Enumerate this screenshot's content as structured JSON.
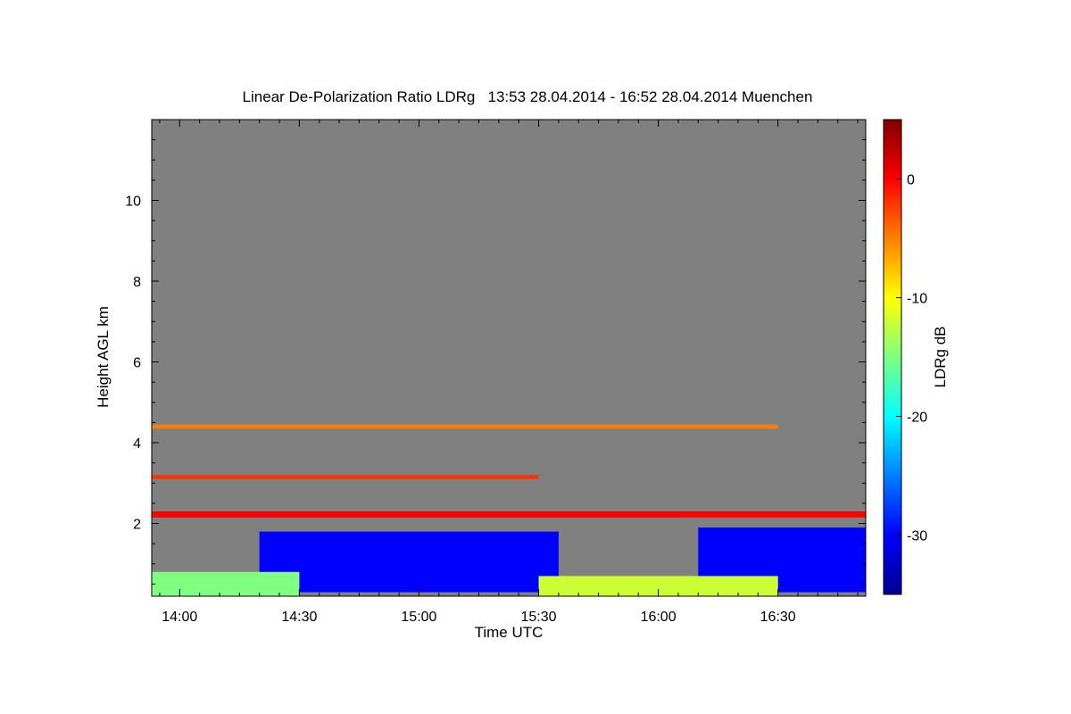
{
  "chart_data": {
    "type": "heatmap",
    "title": "Linear De-Polarization Ratio LDRg   13:53 28.04.2014 - 16:52 28.04.2014 Muenchen",
    "xlabel": "Time UTC",
    "ylabel": "Height AGL km",
    "x_range": [
      "13:53",
      "16:52"
    ],
    "y_range_km": [
      0.2,
      12.0
    ],
    "x_ticks": [
      "14:00",
      "14:30",
      "15:00",
      "15:30",
      "16:00",
      "16:30"
    ],
    "y_ticks": [
      2,
      4,
      6,
      8,
      10
    ],
    "colorbar": {
      "label": "LDRg dB",
      "range": [
        -35,
        5
      ],
      "ticks": [
        0,
        -10,
        -20,
        -30
      ],
      "colormap": "jet"
    },
    "background_color": "#808080",
    "regions": [
      {
        "name": "boundary-layer aerosol (blue)",
        "time_start": "14:20",
        "time_end": "15:35",
        "height_min_km": 0.3,
        "height_max_km": 1.8,
        "ldr_db": -30
      },
      {
        "name": "boundary-layer aerosol (blue)",
        "time_start": "16:10",
        "time_end": "16:52",
        "height_min_km": 0.3,
        "height_max_km": 1.9,
        "ldr_db": -30
      },
      {
        "name": "near-surface mixed layer (cyan-yellow)",
        "time_start": "13:53",
        "time_end": "14:30",
        "height_min_km": 0.2,
        "height_max_km": 0.8,
        "ldr_db": -15
      },
      {
        "name": "near-surface mixed layer (cyan-yellow)",
        "time_start": "15:30",
        "time_end": "16:30",
        "height_min_km": 0.2,
        "height_max_km": 0.7,
        "ldr_db": -12
      },
      {
        "name": "scattered noise line",
        "time_start": "13:53",
        "time_end": "16:30",
        "height_min_km": 4.35,
        "height_max_km": 4.45,
        "ldr_db": -5
      },
      {
        "name": "scattered noise line",
        "time_start": "13:53",
        "time_end": "15:30",
        "height_min_km": 3.1,
        "height_max_km": 3.2,
        "ldr_db": -2
      },
      {
        "name": "scattered noise line",
        "time_start": "13:53",
        "time_end": "16:52",
        "height_min_km": 2.15,
        "height_max_km": 2.3,
        "ldr_db": 0
      }
    ]
  }
}
